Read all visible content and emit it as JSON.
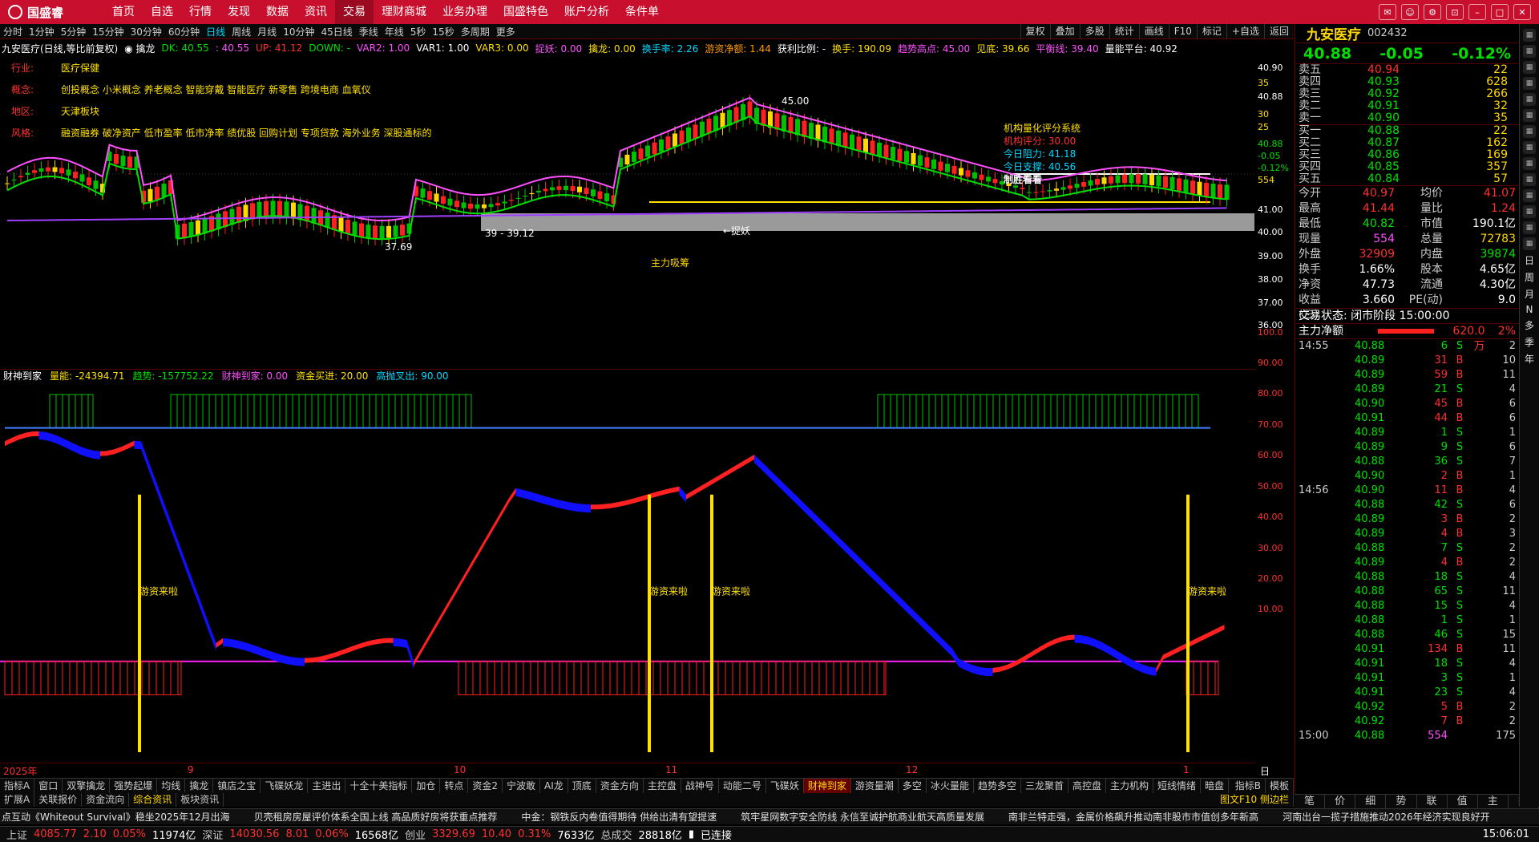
{
  "app": {
    "logo": "国盛睿"
  },
  "menu": [
    "首页",
    "自选",
    "行情",
    "发现",
    "数据",
    "资讯",
    "交易",
    "理财商城",
    "业务办理",
    "国盛特色",
    "账户分析",
    "条件单"
  ],
  "menu_active": "交易",
  "periods": [
    "分时",
    "1分钟",
    "5分钟",
    "15分钟",
    "30分钟",
    "60分钟",
    "日线",
    "周线",
    "月线",
    "10分钟",
    "45日线",
    "季线",
    "年线",
    "5秒",
    "15秒",
    "多周期",
    "更多"
  ],
  "period_active": "日线",
  "right_tools": [
    "复权",
    "叠加",
    "多股",
    "统计",
    "画线",
    "F10",
    "标记",
    "+自选",
    "返回"
  ],
  "indicator_line": [
    {
      "t": "九安医疗(日线,等比前复权)",
      "c": "wht"
    },
    {
      "t": "◉ 擒龙",
      "c": "wht"
    },
    {
      "t": "DK: 40.55",
      "c": "grn"
    },
    {
      "t": ": 40.55",
      "c": "mag"
    },
    {
      "t": "UP: 41.12",
      "c": "red"
    },
    {
      "t": "DOWN: -",
      "c": "grn"
    },
    {
      "t": "VAR2: 1.00",
      "c": "mag"
    },
    {
      "t": "VAR1: 1.00",
      "c": "wht"
    },
    {
      "t": "VAR3: 0.00",
      "c": "yel"
    },
    {
      "t": "捉妖: 0.00",
      "c": "mag"
    },
    {
      "t": "擒龙: 0.00",
      "c": "yel"
    },
    {
      "t": "换手率: 2.26",
      "c": "cyan"
    },
    {
      "t": "游资净额: 1.44",
      "c": "org"
    },
    {
      "t": "获利比例: -",
      "c": "wht"
    },
    {
      "t": "换手: 190.09",
      "c": "yel"
    },
    {
      "t": "趋势高点: 45.00",
      "c": "mag"
    },
    {
      "t": "见底: 39.66",
      "c": "yel"
    },
    {
      "t": "平衡线: 39.40",
      "c": "mag"
    },
    {
      "t": "量能平台: 40.92",
      "c": "wht"
    }
  ],
  "info_labels": [
    {
      "k": "行业:",
      "v": "医疗保健"
    },
    {
      "k": "概念:",
      "v": "创投概念 小米概念 养老概念 智能穿戴 智能医疗 新零售 跨境电商 血氧仪"
    },
    {
      "k": "地区:",
      "v": "天津板块"
    },
    {
      "k": "风格:",
      "v": "融资融券 破净资产 低市盈率 低市净率 绩优股 回购计划 专项贷款 海外业务 深股通标的"
    }
  ],
  "quant_box": {
    "title": "机构量化评分系统",
    "score": "机构评分: 30.00",
    "resist": "今日阻力: 41.18",
    "support": "今日支撑: 40.56",
    "tag": "制胜看看"
  },
  "chart_annotations": {
    "high": "45.00",
    "low": "37.69",
    "range": "39 - 39.12",
    "catch": "←捉妖",
    "main": "主力吸筹"
  },
  "main_axis": [
    "40.90",
    "35",
    "40.88",
    "30",
    "25",
    "40.88",
    "-0.05",
    "-0.12%",
    "554",
    "41.00",
    "40.00",
    "39.00",
    "38.00",
    "37.00",
    "36.00"
  ],
  "sub_header": [
    {
      "t": "财神到家",
      "c": "wht"
    },
    {
      "t": "量能: -24394.71",
      "c": "yel"
    },
    {
      "t": "趋势: -157752.22",
      "c": "grn"
    },
    {
      "t": "财神到家: 0.00",
      "c": "mag"
    },
    {
      "t": "资金买进: 20.00",
      "c": "yel"
    },
    {
      "t": "高抛叉出: 90.00",
      "c": "cyan"
    }
  ],
  "sub_axis": [
    "100.0",
    "90.00",
    "80.00",
    "70.00",
    "60.00",
    "50.00",
    "40.00",
    "30.00",
    "20.00",
    "10.00"
  ],
  "sub_labels": [
    "游资来啦"
  ],
  "x_labels": [
    "2025年",
    "9",
    "10",
    "11",
    "12",
    "1"
  ],
  "x_right": "日线",
  "tabs1": [
    "指标A",
    "窗口",
    "双擎擒龙",
    "强势起爆",
    "均线",
    "擒龙",
    "镇店之宝",
    "飞碟妖龙",
    "主进出",
    "十全十美指标",
    "加仓",
    "转点",
    "资金2",
    "宁波敢",
    "AI龙",
    "顶底",
    "资金方向",
    "主控盘",
    "战神号",
    "动能二号",
    "飞碟妖",
    "财神到家",
    "游资量潮",
    "多空",
    "冰火量能",
    "趋势多空",
    "三龙聚首",
    "高控盘",
    "主力机构",
    "短线情绪",
    "暗盘"
  ],
  "tabs1_active": "财神到家",
  "tabs1_right": [
    "指标B",
    "模板"
  ],
  "tabs2": [
    "扩展A",
    "关联报价",
    "资金流向",
    "综合资讯",
    "板块资讯"
  ],
  "tabs2_active": "综合资讯",
  "tabs2_right": "图文F10 侧边栏",
  "ticker": [
    "点互动《Whiteout Survival》稳坐2025年12月出海",
    "贝壳租房房屋评价体系全国上线 高品质好房将获重点推荐",
    "中金：钢铁反内卷值得期待 供给出清有望提速",
    "筑牢星网数字安全防线 永信至诚护航商业航天高质量发展",
    "南非兰特走强，金属价格飙升推动南非股市市值创多年新高",
    "河南出台一揽子措施推动2026年经济实现良好开"
  ],
  "status": {
    "sh_name": "上证",
    "sh": "4085.77",
    "sh_ch": "2.10",
    "sh_pct": "0.05%",
    "sh_amt": "11974亿",
    "sz_name": "深证",
    "sz": "14030.56",
    "sz_ch": "8.01",
    "sz_pct": "0.06%",
    "sz_amt": "16568亿",
    "cy_name": "创业",
    "cy": "3329.69",
    "cy_ch": "10.40",
    "cy_pct": "0.31%",
    "cy_amt": "7633亿",
    "total_name": "总成交",
    "total": "28818亿",
    "conn": "已连接",
    "time": "15:06:01"
  },
  "stock": {
    "name": "九安医疗",
    "code": "002432",
    "price": "40.88",
    "change": "-0.05",
    "pct": "-0.12%"
  },
  "asks": [
    {
      "l": "卖五",
      "p": "40.94",
      "v": "22"
    },
    {
      "l": "卖四",
      "p": "40.93",
      "v": "628"
    },
    {
      "l": "卖三",
      "p": "40.92",
      "v": "266"
    },
    {
      "l": "卖二",
      "p": "40.91",
      "v": "32"
    },
    {
      "l": "卖一",
      "p": "40.90",
      "v": "35"
    }
  ],
  "bids": [
    {
      "l": "买一",
      "p": "40.88",
      "v": "22"
    },
    {
      "l": "买二",
      "p": "40.87",
      "v": "162"
    },
    {
      "l": "买三",
      "p": "40.86",
      "v": "169"
    },
    {
      "l": "买四",
      "p": "40.85",
      "v": "357"
    },
    {
      "l": "买五",
      "p": "40.84",
      "v": "57"
    }
  ],
  "quote": [
    {
      "a": "今开",
      "b": "40.97",
      "bc": "red",
      "c": "均价",
      "d": "41.07",
      "dc": "red"
    },
    {
      "a": "最高",
      "b": "41.44",
      "bc": "red",
      "c": "量比",
      "d": "1.24",
      "dc": "red"
    },
    {
      "a": "最低",
      "b": "40.82",
      "bc": "grn",
      "c": "市值",
      "d": "190.1亿",
      "dc": "wht"
    },
    {
      "a": "现量",
      "b": "554",
      "bc": "mag",
      "c": "总量",
      "d": "72783",
      "dc": "yel"
    },
    {
      "a": "外盘",
      "b": "32909",
      "bc": "red",
      "c": "内盘",
      "d": "39874",
      "dc": "grn"
    },
    {
      "a": "换手",
      "b": "1.66%",
      "bc": "wht",
      "c": "股本",
      "d": "4.65亿",
      "dc": "wht"
    },
    {
      "a": "净资",
      "b": "47.73",
      "bc": "wht",
      "c": "流通",
      "d": "4.30亿",
      "dc": "wht"
    },
    {
      "a": "收益(三)",
      "b": "3.660",
      "bc": "wht",
      "c": "PE(动)",
      "d": "9.0",
      "dc": "wht"
    }
  ],
  "trade_state": "交易状态: 闭市阶段 15:00:00",
  "main_net": {
    "label": "主力净额",
    "value": "620.0万",
    "pct": "2%"
  },
  "ticks": [
    {
      "t": "14:55",
      "p": "40.88",
      "v": "6",
      "s": "S",
      "n": "2"
    },
    {
      "t": "",
      "p": "40.89",
      "v": "31",
      "s": "B",
      "n": "10"
    },
    {
      "t": "",
      "p": "40.89",
      "v": "59",
      "s": "B",
      "n": "11"
    },
    {
      "t": "",
      "p": "40.89",
      "v": "21",
      "s": "S",
      "n": "4"
    },
    {
      "t": "",
      "p": "40.90",
      "v": "45",
      "s": "B",
      "n": "6"
    },
    {
      "t": "",
      "p": "40.91",
      "v": "44",
      "s": "B",
      "n": "6"
    },
    {
      "t": "",
      "p": "40.89",
      "v": "1",
      "s": "S",
      "n": "1"
    },
    {
      "t": "",
      "p": "40.89",
      "v": "9",
      "s": "S",
      "n": "6"
    },
    {
      "t": "",
      "p": "40.88",
      "v": "36",
      "s": "S",
      "n": "7"
    },
    {
      "t": "",
      "p": "40.90",
      "v": "2",
      "s": "B",
      "n": "1"
    },
    {
      "t": "14:56",
      "p": "40.90",
      "v": "11",
      "s": "B",
      "n": "4"
    },
    {
      "t": "",
      "p": "40.88",
      "v": "42",
      "s": "S",
      "n": "6"
    },
    {
      "t": "",
      "p": "40.89",
      "v": "3",
      "s": "B",
      "n": "2"
    },
    {
      "t": "",
      "p": "40.89",
      "v": "4",
      "s": "B",
      "n": "3"
    },
    {
      "t": "",
      "p": "40.88",
      "v": "7",
      "s": "S",
      "n": "2"
    },
    {
      "t": "",
      "p": "40.89",
      "v": "4",
      "s": "B",
      "n": "2"
    },
    {
      "t": "",
      "p": "40.88",
      "v": "18",
      "s": "S",
      "n": "4"
    },
    {
      "t": "",
      "p": "40.88",
      "v": "65",
      "s": "S",
      "n": "11"
    },
    {
      "t": "",
      "p": "40.88",
      "v": "15",
      "s": "S",
      "n": "4"
    },
    {
      "t": "",
      "p": "40.88",
      "v": "1",
      "s": "S",
      "n": "1"
    },
    {
      "t": "",
      "p": "40.88",
      "v": "46",
      "s": "S",
      "n": "15"
    },
    {
      "t": "",
      "p": "40.91",
      "v": "134",
      "s": "B",
      "n": "11"
    },
    {
      "t": "",
      "p": "40.91",
      "v": "18",
      "s": "S",
      "n": "4"
    },
    {
      "t": "",
      "p": "40.91",
      "v": "3",
      "s": "S",
      "n": "1"
    },
    {
      "t": "",
      "p": "40.91",
      "v": "23",
      "s": "S",
      "n": "4"
    },
    {
      "t": "",
      "p": "40.92",
      "v": "5",
      "s": "B",
      "n": "2"
    },
    {
      "t": "",
      "p": "40.92",
      "v": "7",
      "s": "B",
      "n": "2"
    },
    {
      "t": "15:00",
      "p": "40.88",
      "v": "554",
      "s": "",
      "n": "175"
    }
  ],
  "rtabs": [
    "笔",
    "价",
    "细",
    "势",
    "联",
    "值",
    "主",
    "筹"
  ],
  "side_vert": [
    "日",
    "周",
    "月",
    "N",
    "多",
    "季",
    "年"
  ]
}
